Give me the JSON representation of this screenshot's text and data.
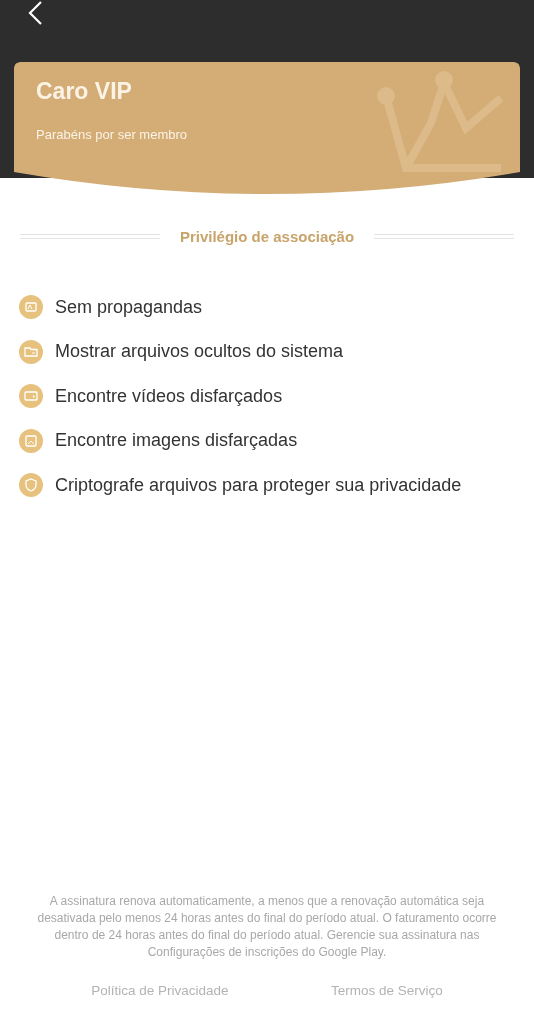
{
  "card": {
    "title": "Caro VIP",
    "subtitle": "Parabéns por ser membro"
  },
  "section_title": "Privilégio de associação",
  "features": [
    {
      "kind": "ads",
      "label": "Sem propagandas"
    },
    {
      "kind": "folder",
      "label": "Mostrar arquivos ocultos do sistema"
    },
    {
      "kind": "video",
      "label": "Encontre vídeos disfarçados"
    },
    {
      "kind": "image",
      "label": "Encontre imagens disfarçadas"
    },
    {
      "kind": "shield",
      "label": "Criptografe arquivos para proteger sua privacidade"
    }
  ],
  "disclaimer": "A assinatura renova automaticamente, a menos que a renovação automática seja desativada pelo menos 24 horas antes do final do período atual. O faturamento ocorre dentro de 24 horas antes do final do período atual. Gerencie sua assinatura nas Configurações de inscrições do Google Play.",
  "links": [
    "Política de Privacidade",
    "Termos de Serviço"
  ]
}
